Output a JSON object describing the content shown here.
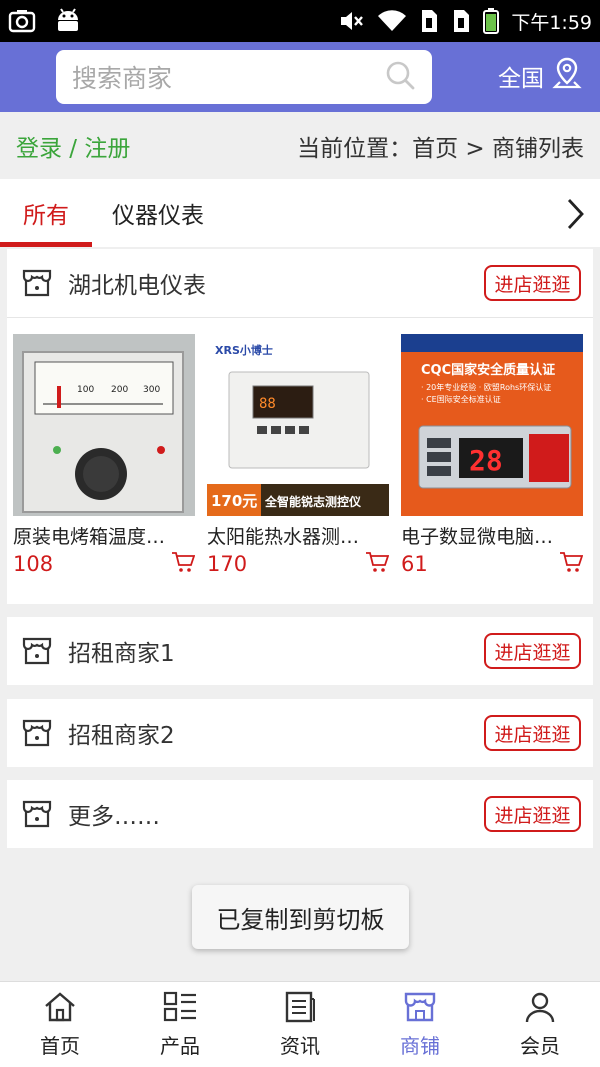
{
  "status_bar": {
    "time": "下午1:59"
  },
  "header": {
    "search_placeholder": "搜索商家",
    "region_label": "全国"
  },
  "breadcrumb": {
    "login_label": "登录 / 注册",
    "location": "当前位置：首页 > 商铺列表"
  },
  "tabs": [
    {
      "label": "所有",
      "active": true
    },
    {
      "label": "仪器仪表",
      "active": false
    }
  ],
  "shops": [
    {
      "name": "湖北机电仪表",
      "button": "进店逛逛",
      "products": [
        {
          "title": "原装电烤箱温度…",
          "price": "108"
        },
        {
          "title": "太阳能热水器测…",
          "price": "170",
          "banner_price": "170元",
          "banner_text": "全智能锐志测控仪",
          "brand": "XRS小博士"
        },
        {
          "title": "电子数显微电脑…",
          "price": "61",
          "banner_title": "CQC国家安全质量认证",
          "banner_line1": "· 20年专业经验 · 欧盟Rohs环保认证",
          "banner_line2": "· CE国际安全标准认证",
          "display_value": "28"
        }
      ]
    },
    {
      "name": "招租商家1",
      "button": "进店逛逛"
    },
    {
      "name": "招租商家2",
      "button": "进店逛逛"
    },
    {
      "name": "更多……",
      "button": "进店逛逛"
    }
  ],
  "toast": "已复制到剪切板",
  "bottom_nav": [
    {
      "label": "首页",
      "icon": "home-icon"
    },
    {
      "label": "产品",
      "icon": "grid-list-icon"
    },
    {
      "label": "资讯",
      "icon": "news-icon"
    },
    {
      "label": "商铺",
      "icon": "store-icon",
      "active": true
    },
    {
      "label": "会员",
      "icon": "user-icon"
    }
  ],
  "colors": {
    "accent": "#6870d6",
    "red": "#d01b1b",
    "green": "#3ba53b"
  }
}
